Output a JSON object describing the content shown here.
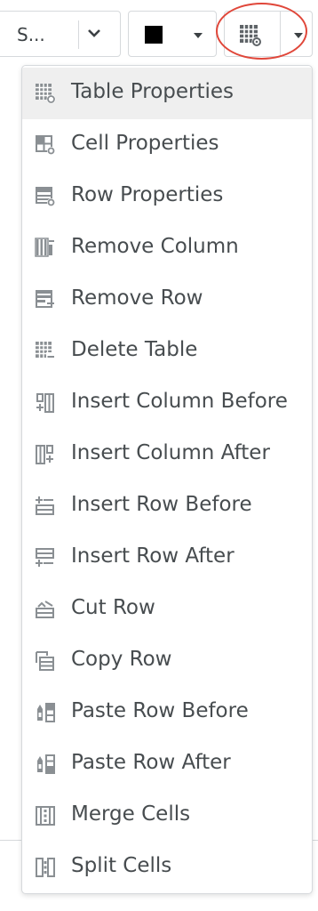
{
  "toolbar": {
    "font_select_value": "S...",
    "text_color": "#000000"
  },
  "menu": {
    "items": [
      {
        "label": "Table Properties",
        "icon": "table-properties-icon",
        "active": true
      },
      {
        "label": "Cell Properties",
        "icon": "cell-properties-icon"
      },
      {
        "label": "Row Properties",
        "icon": "row-properties-icon"
      },
      {
        "label": "Remove Column",
        "icon": "remove-column-icon"
      },
      {
        "label": "Remove Row",
        "icon": "remove-row-icon"
      },
      {
        "label": "Delete Table",
        "icon": "delete-table-icon"
      },
      {
        "label": "Insert Column Before",
        "icon": "insert-column-before-icon"
      },
      {
        "label": "Insert Column After",
        "icon": "insert-column-after-icon"
      },
      {
        "label": "Insert Row Before",
        "icon": "insert-row-before-icon"
      },
      {
        "label": "Insert Row After",
        "icon": "insert-row-after-icon"
      },
      {
        "label": "Cut Row",
        "icon": "cut-row-icon"
      },
      {
        "label": "Copy Row",
        "icon": "copy-row-icon"
      },
      {
        "label": "Paste Row Before",
        "icon": "paste-row-before-icon"
      },
      {
        "label": "Paste Row After",
        "icon": "paste-row-after-icon"
      },
      {
        "label": "Merge Cells",
        "icon": "merge-cells-icon"
      },
      {
        "label": "Split Cells",
        "icon": "split-cells-icon"
      }
    ]
  },
  "colors": {
    "text": "#474c4f",
    "icon": "#8a8f93",
    "highlight_ring": "#e0473a",
    "active_bg": "#efefef",
    "border": "#d6d9dc"
  }
}
